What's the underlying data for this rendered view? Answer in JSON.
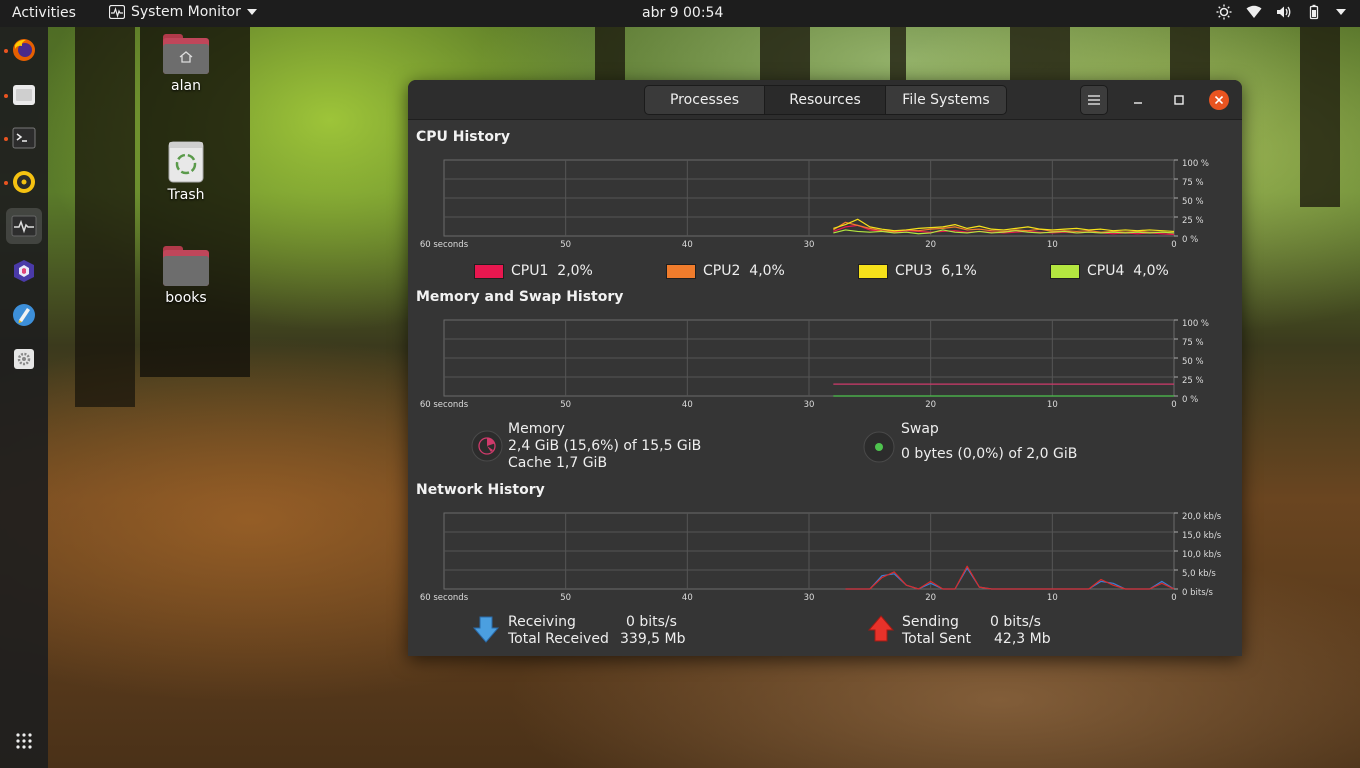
{
  "topbar": {
    "activities": "Activities",
    "app_menu": "System Monitor",
    "clock": "abr 9  00:54"
  },
  "dock": {
    "items": [
      "firefox",
      "files",
      "terminal",
      "rhythmbox",
      "system-monitor",
      "app-6",
      "app-7",
      "settings"
    ]
  },
  "desktop": {
    "icons": [
      {
        "label": "alan"
      },
      {
        "label": "Trash"
      },
      {
        "label": "books"
      }
    ]
  },
  "window": {
    "tabs": [
      "Processes",
      "Resources",
      "File Systems"
    ],
    "active_tab": "Resources",
    "cpu": {
      "title": "CPU History",
      "legend": [
        {
          "name": "CPU1",
          "value": "2,0%",
          "color": "#e8174f"
        },
        {
          "name": "CPU2",
          "value": "4,0%",
          "color": "#f07c2c"
        },
        {
          "name": "CPU3",
          "value": "6,1%",
          "color": "#f6e11a"
        },
        {
          "name": "CPU4",
          "value": "4,0%",
          "color": "#b4e640"
        }
      ]
    },
    "memory": {
      "title": "Memory and Swap History",
      "mem_label": "Memory",
      "mem_value": "2,4 GiB (15,6%) of 15,5 GiB",
      "cache": "Cache 1,7 GiB",
      "swap_label": "Swap",
      "swap_value": "0 bytes (0,0%) of 2,0 GiB"
    },
    "network": {
      "title": "Network History",
      "receiving_label": "Receiving",
      "receiving_value": "0 bits/s",
      "total_received_label": "Total Received",
      "total_received_value": "339,5 Mb",
      "sending_label": "Sending",
      "sending_value": "0 bits/s",
      "total_sent_label": "Total Sent",
      "total_sent_value": "42,3 Mb"
    }
  },
  "chart_data": [
    {
      "type": "line",
      "title": "CPU History",
      "x_ticks": [
        "60 seconds",
        "50",
        "40",
        "30",
        "20",
        "10",
        "0"
      ],
      "y_ticks": [
        "100 %",
        "75 %",
        "50 %",
        "25 %",
        "0 %"
      ],
      "ylim": [
        0,
        100
      ],
      "x": [
        28,
        27,
        26,
        25,
        24,
        23,
        22,
        21,
        20,
        19,
        18,
        17,
        16,
        15,
        14,
        13,
        12,
        11,
        10,
        9,
        8,
        7,
        6,
        5,
        4,
        3,
        2,
        1,
        0
      ],
      "series": [
        {
          "name": "CPU1",
          "color": "#e8174f",
          "values": [
            6,
            12,
            14,
            8,
            6,
            5,
            7,
            6,
            5,
            6,
            7,
            5,
            6,
            5,
            4,
            5,
            6,
            5,
            4,
            5,
            4,
            5,
            4,
            3,
            4,
            3,
            4,
            3,
            2
          ]
        },
        {
          "name": "CPU2",
          "color": "#f07c2c",
          "values": [
            8,
            18,
            14,
            10,
            7,
            6,
            8,
            7,
            9,
            10,
            12,
            8,
            9,
            7,
            6,
            8,
            7,
            9,
            6,
            7,
            6,
            7,
            5,
            6,
            5,
            6,
            5,
            5,
            4
          ]
        },
        {
          "name": "CPU3",
          "color": "#f6e11a",
          "values": [
            10,
            15,
            22,
            12,
            9,
            7,
            8,
            10,
            11,
            12,
            15,
            10,
            13,
            9,
            8,
            10,
            12,
            9,
            8,
            9,
            10,
            8,
            9,
            7,
            8,
            7,
            8,
            7,
            6
          ]
        },
        {
          "name": "CPU4",
          "color": "#b4e640",
          "values": [
            4,
            8,
            6,
            5,
            6,
            4,
            5,
            3,
            4,
            8,
            5,
            4,
            6,
            4,
            5,
            7,
            5,
            4,
            5,
            6,
            4,
            5,
            4,
            5,
            4,
            5,
            4,
            5,
            4
          ]
        }
      ]
    },
    {
      "type": "line",
      "title": "Memory and Swap History",
      "x_ticks": [
        "60 seconds",
        "50",
        "40",
        "30",
        "20",
        "10",
        "0"
      ],
      "y_ticks": [
        "100 %",
        "75 %",
        "50 %",
        "25 %",
        "0 %"
      ],
      "ylim": [
        0,
        100
      ],
      "x": [
        28,
        0
      ],
      "series": [
        {
          "name": "Memory",
          "color": "#cf3a6b",
          "values": [
            15.6,
            15.6
          ]
        },
        {
          "name": "Swap",
          "color": "#4ec34e",
          "values": [
            0,
            0
          ]
        }
      ]
    },
    {
      "type": "line",
      "title": "Network History",
      "x_ticks": [
        "60 seconds",
        "50",
        "40",
        "30",
        "20",
        "10",
        "0"
      ],
      "y_ticks": [
        "20,0 kb/s",
        "15,0 kb/s",
        "10,0 kb/s",
        "5,0 kb/s",
        "0 bits/s"
      ],
      "ylim": [
        0,
        20
      ],
      "x": [
        27,
        26,
        25,
        24,
        23,
        22,
        21,
        20,
        19,
        18,
        17,
        16,
        15,
        14,
        13,
        12,
        11,
        10,
        9,
        8,
        7,
        6,
        5,
        4,
        3,
        2,
        1,
        0
      ],
      "series": [
        {
          "name": "Receiving",
          "color": "#3c7fd4",
          "values": [
            0,
            0,
            0,
            3.5,
            4,
            1,
            0,
            1.5,
            0,
            0,
            5.5,
            0.5,
            0,
            0,
            0,
            0,
            0,
            0,
            0,
            0,
            0,
            2,
            1.5,
            0,
            0,
            0,
            2,
            0
          ]
        },
        {
          "name": "Sending",
          "color": "#d92b2b",
          "values": [
            0,
            0,
            0,
            3,
            4.5,
            1,
            0,
            2,
            0,
            0,
            6,
            0.5,
            0,
            0,
            0,
            0,
            0,
            0,
            0,
            0,
            0,
            2.5,
            1,
            0,
            0,
            0,
            1.5,
            0
          ]
        }
      ]
    }
  ]
}
